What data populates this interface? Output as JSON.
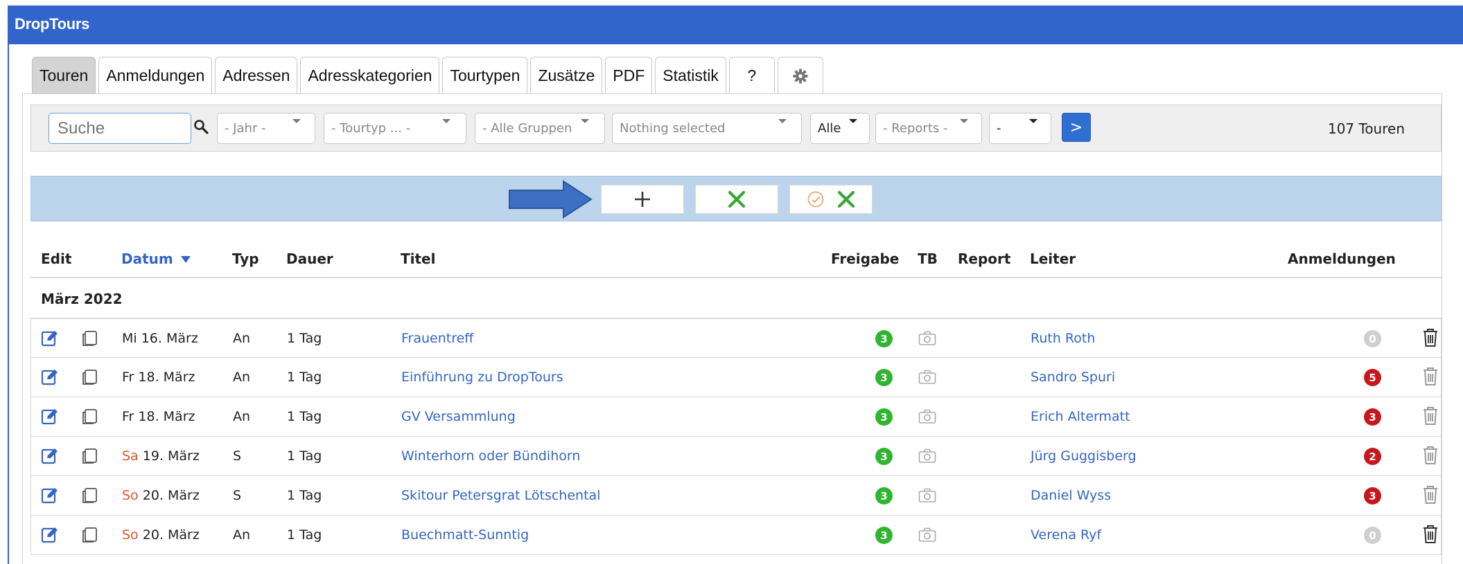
{
  "app": {
    "title": "DropTours"
  },
  "tabs": [
    {
      "label": "Touren",
      "active": true
    },
    {
      "label": "Anmeldungen"
    },
    {
      "label": "Adressen"
    },
    {
      "label": "Adresskategorien"
    },
    {
      "label": "Tourtypen"
    },
    {
      "label": "Zusätze"
    },
    {
      "label": "PDF"
    },
    {
      "label": "Statistik"
    },
    {
      "label": "?"
    },
    {
      "label": "",
      "icon": "gear-icon"
    }
  ],
  "filters": {
    "search_placeholder": "Suche",
    "year": "- Jahr -",
    "tourtype": "- Tourtyp ... -",
    "groups": "- Alle Gruppen",
    "multi": "Nothing selected",
    "all": "Alle",
    "reports": "- Reports -",
    "misc": "-",
    "go_label": ">",
    "count": "107 Touren"
  },
  "actions": {
    "add_icon": "plus-icon",
    "cancel_icon": "x-icon",
    "confirm_cancel_icon": "check-circle-icon"
  },
  "table": {
    "columns": {
      "edit": "Edit",
      "date": "Datum",
      "type": "Typ",
      "duration": "Dauer",
      "title": "Titel",
      "release": "Freigabe",
      "tb": "TB",
      "report": "Report",
      "leader": "Leiter",
      "registrations": "Anmeldungen"
    },
    "group_title": "März 2022",
    "rows": [
      {
        "day": "Mi",
        "date": "16. März",
        "weekend": false,
        "type": "An",
        "duration": "1 Tag",
        "title": "Frauentreff",
        "release": "3",
        "leader": "Ruth Roth",
        "registrations": "0",
        "reg_zero": true
      },
      {
        "day": "Fr",
        "date": "18. März",
        "weekend": false,
        "type": "An",
        "duration": "1 Tag",
        "title": "Einführung zu DropTours",
        "release": "3",
        "leader": "Sandro Spuri",
        "registrations": "5",
        "reg_zero": false
      },
      {
        "day": "Fr",
        "date": "18. März",
        "weekend": false,
        "type": "An",
        "duration": "1 Tag",
        "title": "GV Versammlung",
        "release": "3",
        "leader": "Erich Altermatt",
        "registrations": "3",
        "reg_zero": false
      },
      {
        "day": "Sa",
        "date": "19. März",
        "weekend": true,
        "type": "S",
        "duration": "1 Tag",
        "title": "Winterhorn oder Bündihorn",
        "release": "3",
        "leader": "Jürg Guggisberg",
        "registrations": "2",
        "reg_zero": false
      },
      {
        "day": "So",
        "date": "20. März",
        "weekend": true,
        "type": "S",
        "duration": "1 Tag",
        "title": "Skitour Petersgrat Lötschental",
        "release": "3",
        "leader": "Daniel Wyss",
        "registrations": "3",
        "reg_zero": false
      },
      {
        "day": "So",
        "date": "20. März",
        "weekend": true,
        "type": "An",
        "duration": "1 Tag",
        "title": "Buechmatt-Sunntig",
        "release": "3",
        "leader": "Verena Ryf",
        "registrations": "0",
        "reg_zero": true
      }
    ]
  },
  "colors": {
    "brand": "#3165cc",
    "link": "#3465c4",
    "release_badge": "#2fb52f",
    "registration_badge": "#c8161d",
    "zero_badge": "#cfcfcf",
    "weekend": "#e0542c",
    "action_bar": "#bcd5ec"
  }
}
